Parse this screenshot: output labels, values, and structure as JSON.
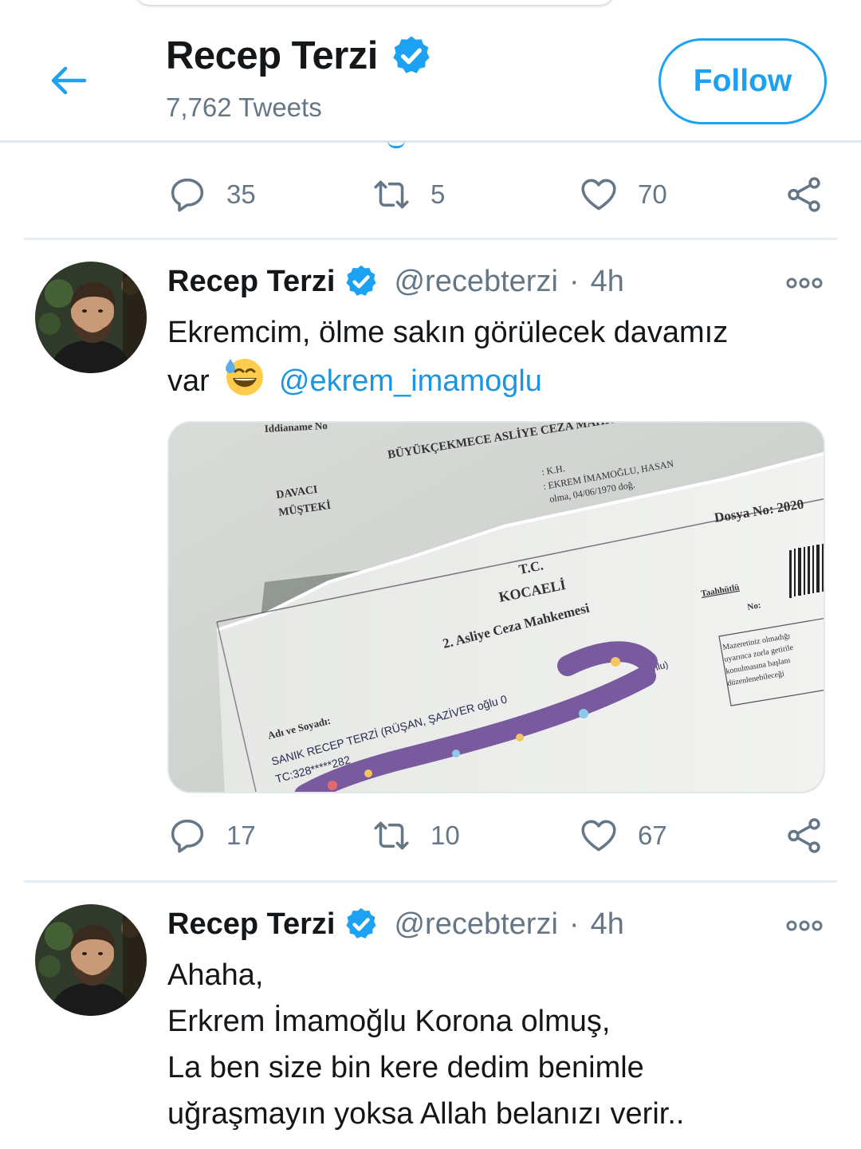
{
  "header": {
    "name": "Recep Terzi",
    "tweet_count": "7,762 Tweets",
    "follow_label": "Follow",
    "back_icon": "arrow-left-icon",
    "verified_icon": "verified-badge-icon"
  },
  "colors": {
    "accent": "#1da1f2",
    "text": "#14171a",
    "muted": "#657786",
    "divider": "#e6ecf0"
  },
  "prev_tweet": {
    "replies": "35",
    "retweets": "5",
    "likes": "70"
  },
  "tweets": [
    {
      "name": "Recep Terzi",
      "handle": "@recebterzi",
      "separator": "·",
      "time": "4h",
      "text_part1": "Ekremcim, ölme sakın görülecek davamız",
      "text_part2": "var",
      "emoji_icon": "grinning-sweat-emoji",
      "mention": "@ekrem_imamoglu",
      "media": {
        "doc_top_court": "BÜYÜKÇEKMECE ASLİYE CEZA MAHKEMESİ",
        "davaci": "DAVACI",
        "musteki": "MÜŞTEKİ",
        "kh": ": K.H.",
        "ekrem": ": EKREM İMAMOĞLU, HASAN",
        "olma": "olma, 04/06/1970 doğ.",
        "dosya_no": "Dosya No: 2020",
        "tc": "T.C.",
        "kocaeli": "KOCAELİ",
        "court": "2. Asliye Ceza Mahkemesi",
        "taahhutlu": "Taahhütlü",
        "no": "No:",
        "mazeret": "Mazeretiniz olmadığı",
        "adi_soyadi": "Adı ve Soyadı:",
        "sanik": "SANIK RECEP TERZİ (RÜŞAN, ŞAZİVER oğlu 0",
        "tc_no": "TC:328*****282",
        "ogumlu": "oğumlu)"
      },
      "replies": "17",
      "retweets": "10",
      "likes": "67"
    },
    {
      "name": "Recep Terzi",
      "handle": "@recebterzi",
      "separator": "·",
      "time": "4h",
      "lines": [
        "Ahaha,",
        "Erkrem İmamoğlu Korona olmuş,",
        "La ben size bin kere dedim benimle",
        "uğraşmayın yoksa Allah belanızı verir.."
      ]
    }
  ]
}
